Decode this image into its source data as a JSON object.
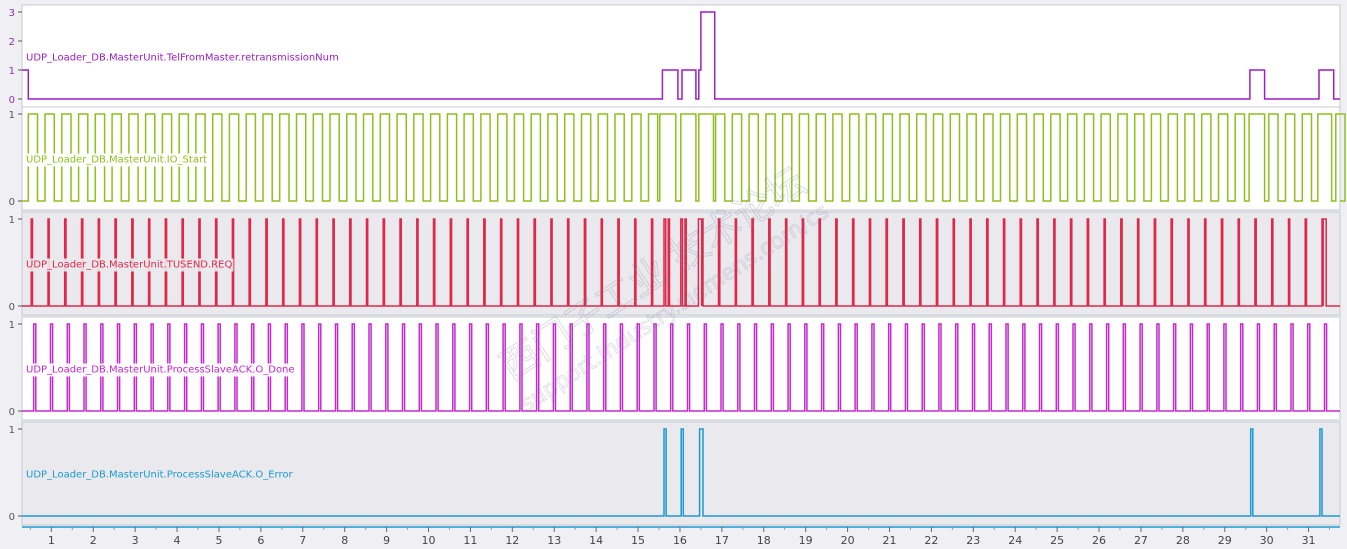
{
  "chart_data": {
    "type": "line",
    "title": "",
    "xlabel": "",
    "x_range": [
      0.3,
      31.75
    ],
    "x_ticks": [
      1,
      2,
      3,
      4,
      5,
      6,
      7,
      8,
      9,
      10,
      11,
      12,
      13,
      14,
      15,
      16,
      17,
      18,
      19,
      20,
      21,
      22,
      23,
      24,
      25,
      26,
      27,
      28,
      29,
      30,
      31
    ],
    "series": [
      {
        "name": "UDP_Loader_DB.MasterUnit.TelFromMaster.retransmissionNum",
        "color": "#9b1fc4",
        "background": "#ffffff",
        "y_range": [
          0,
          3
        ],
        "y_ticks": [
          0,
          1,
          2,
          3
        ],
        "steps": [
          [
            0.3,
            1
          ],
          [
            0.45,
            0
          ],
          [
            15.58,
            1
          ],
          [
            15.95,
            0
          ],
          [
            16.05,
            1
          ],
          [
            16.38,
            0
          ],
          [
            16.45,
            1
          ],
          [
            16.5,
            3
          ],
          [
            16.83,
            0
          ],
          [
            29.6,
            1
          ],
          [
            29.95,
            0
          ],
          [
            31.25,
            1
          ],
          [
            31.6,
            0
          ]
        ]
      },
      {
        "name": "UDP_Loader_DB.MasterUnit.IO_Start",
        "color": "#8fbf1f",
        "background": "#ffffff",
        "y_range": [
          0,
          1
        ],
        "y_ticks": [
          0,
          1
        ],
        "pulses": {
          "start": 0.45,
          "period": 0.4,
          "width": 0.22,
          "end": 31.7
        },
        "extra_highs": [
          [
            15.52,
            15.9
          ],
          [
            16.02,
            16.38
          ],
          [
            16.45,
            16.8
          ],
          [
            29.58,
            29.95
          ],
          [
            31.22,
            31.55
          ]
        ]
      },
      {
        "name": "UDP_Loader_DB.MasterUnit.TUSEND.REQ",
        "color": "#e02848",
        "background": "#e9e9ee",
        "y_range": [
          0,
          1
        ],
        "y_ticks": [
          0,
          1
        ],
        "pulses": {
          "start": 0.52,
          "period": 0.4,
          "width": 0.03,
          "end": 31.7
        },
        "extra_highs": [
          [
            15.62,
            15.66
          ],
          [
            16.02,
            16.06
          ],
          [
            16.44,
            16.52
          ],
          [
            31.35,
            31.42
          ]
        ]
      },
      {
        "name": "UDP_Loader_DB.MasterUnit.ProcessSlaveACK.O_Done",
        "color": "#c32ad0",
        "background": "#ffffff",
        "y_range": [
          0,
          1
        ],
        "y_ticks": [
          0,
          1
        ],
        "pulses": {
          "start": 0.58,
          "period": 0.4,
          "width": 0.05,
          "end": 31.7
        }
      },
      {
        "name": "UDP_Loader_DB.MasterUnit.ProcessSlaveACK.O_Error",
        "color": "#1a9ad2",
        "background": "#e9e9ee",
        "y_range": [
          0,
          1
        ],
        "y_ticks": [
          0,
          1
        ],
        "steps": [
          [
            0.3,
            0
          ],
          [
            15.62,
            1
          ],
          [
            15.67,
            0
          ],
          [
            16.03,
            1
          ],
          [
            16.08,
            0
          ],
          [
            16.47,
            1
          ],
          [
            16.55,
            0
          ],
          [
            29.62,
            1
          ],
          [
            29.67,
            0
          ],
          [
            31.27,
            1
          ],
          [
            31.32,
            0
          ]
        ]
      }
    ]
  },
  "watermark": {
    "line1": "西门子工业 技术论坛",
    "line2": "support.industry.siemens.com/cs"
  }
}
